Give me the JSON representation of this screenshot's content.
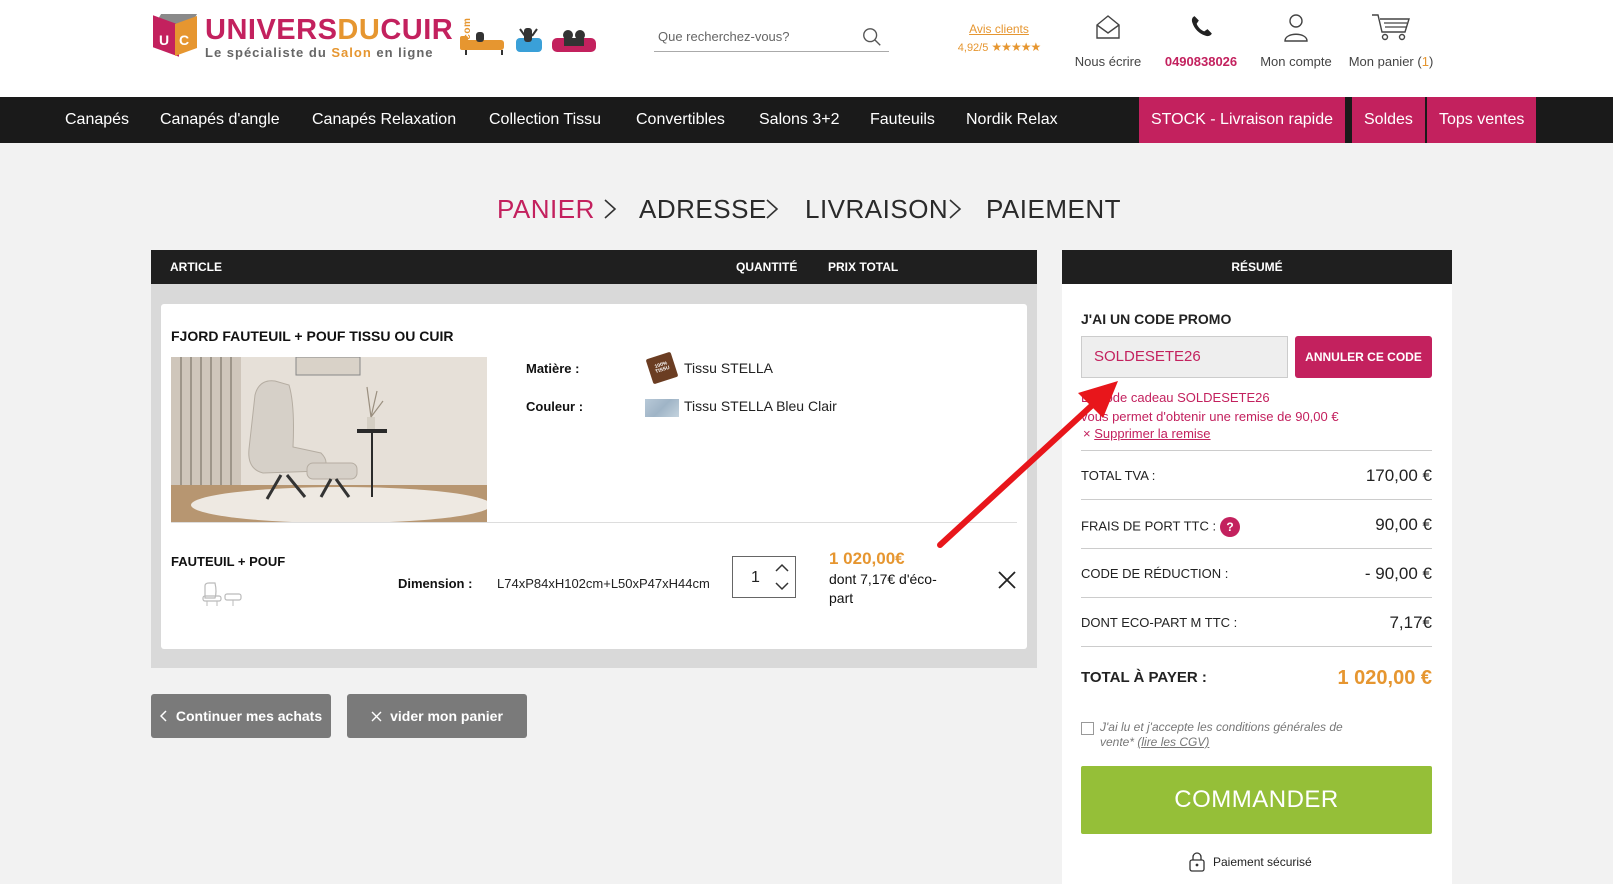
{
  "header": {
    "logo": {
      "part1": "UNIVERS",
      "part2": "DU",
      "part3": "CUIR",
      "com": ".com",
      "tagline_a": "Le spécialiste du ",
      "tagline_b": "Salon",
      "tagline_c": " en ligne"
    },
    "search": {
      "placeholder": "Que recherchez-vous?"
    },
    "avis": {
      "link": "Avis clients",
      "score": "4,92/5",
      "stars": "★★★★★"
    },
    "contact": {
      "label": "Nous écrire",
      "icon": "envelope-icon"
    },
    "phone": {
      "label": "0490838026",
      "icon": "phone-icon"
    },
    "account": {
      "label": "Mon compte",
      "icon": "user-icon"
    },
    "cart": {
      "label": "Mon panier (",
      "count": "1",
      "close": ")",
      "icon": "cart-icon"
    }
  },
  "nav": {
    "items": [
      "Canapés",
      "Canapés d'angle",
      "Canapés Relaxation",
      "Collection Tissu",
      "Convertibles",
      "Salons 3+2",
      "Fauteuils",
      "Nordik Relax"
    ],
    "highlight": [
      "STOCK - Livraison rapide",
      "Soldes",
      "Tops ventes"
    ]
  },
  "steps": [
    "PANIER",
    "ADRESSE",
    "LIVRAISON",
    "PAIEMENT"
  ],
  "cart": {
    "headers": {
      "article": "ARTICLE",
      "quantity": "QUANTITÉ",
      "total_price": "PRIX TOTAL"
    },
    "product": {
      "title": "FJORD FAUTEUIL + POUF TISSU OU CUIR",
      "matiere_label": "Matière :",
      "matiere_value": "Tissu STELLA",
      "matiere_badge": "100% TISSU",
      "couleur_label": "Couleur :",
      "couleur_value": "Tissu STELLA Bleu Clair",
      "line_title": "FAUTEUIL + POUF",
      "dimension_label": "Dimension :",
      "dimension_value": "L74xP84xH102cm+L50xP47xH44cm",
      "quantity": "1",
      "price": "1 020,00€",
      "eco": "dont 7,17€ d'éco-part"
    },
    "continue_label": "Continuer mes achats",
    "empty_label": "vider mon panier"
  },
  "summary": {
    "title": "RÉSUMÉ",
    "promo_title": "J'AI UN CODE PROMO",
    "promo_code": "SOLDESETE26",
    "promo_cancel": "ANNULER CE CODE",
    "promo_msg1": "Le code cadeau SOLDESETE26",
    "promo_msg2": "vous permet d'obtenir une remise de 90,00 €",
    "promo_delete": "Supprimer la remise",
    "rows": [
      {
        "label": "TOTAL TVA :",
        "value": "170,00 €"
      },
      {
        "label": "FRAIS DE PORT TTC :",
        "value": "90,00 €"
      },
      {
        "label": "CODE DE RÉDUCTION :",
        "value": "- 90,00 €"
      },
      {
        "label": "DONT ECO-PART M TTC :",
        "value": "7,17€"
      }
    ],
    "total_label": "TOTAL À PAYER :",
    "total_value": "1 020,00 €",
    "cgv_text": "J'ai lu et j'accepte les conditions générales de vente* ",
    "cgv_link": "(lire les CGV)",
    "order_button": "COMMANDER",
    "secure": "Paiement sécurisé"
  },
  "colors": {
    "brand_pink": "#c3215e",
    "brand_orange": "#e69630",
    "order_green": "#95bf38",
    "annotation_arrow": "#e8161b"
  }
}
